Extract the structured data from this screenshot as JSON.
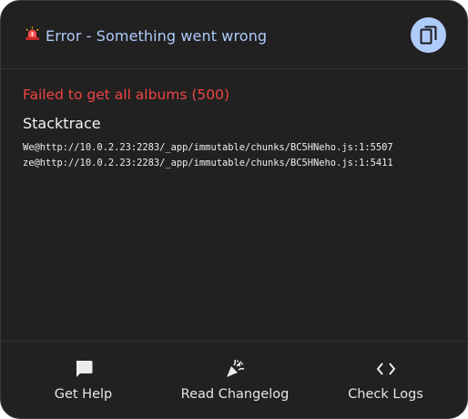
{
  "header": {
    "icon": "siren-icon",
    "title": "Error - Something went wrong",
    "copy_icon": "copy-icon"
  },
  "error": {
    "message": "Failed to get all albums (500)",
    "stack_heading": "Stacktrace",
    "stack_lines": [
      "We@http://10.0.2.23:2283/_app/immutable/chunks/BC5HNeho.js:1:5507",
      "ze@http://10.0.2.23:2283/_app/immutable/chunks/BC5HNeho.js:1:5411"
    ]
  },
  "footer": {
    "actions": [
      {
        "label": "Get Help",
        "icon": "chat-bubble-icon"
      },
      {
        "label": "Read Changelog",
        "icon": "party-popper-icon"
      },
      {
        "label": "Check Logs",
        "icon": "code-brackets-icon"
      }
    ]
  },
  "colors": {
    "panel_bg": "#212121",
    "accent": "#aecbfa",
    "error": "#ef4444",
    "text": "#f2f2f2"
  }
}
